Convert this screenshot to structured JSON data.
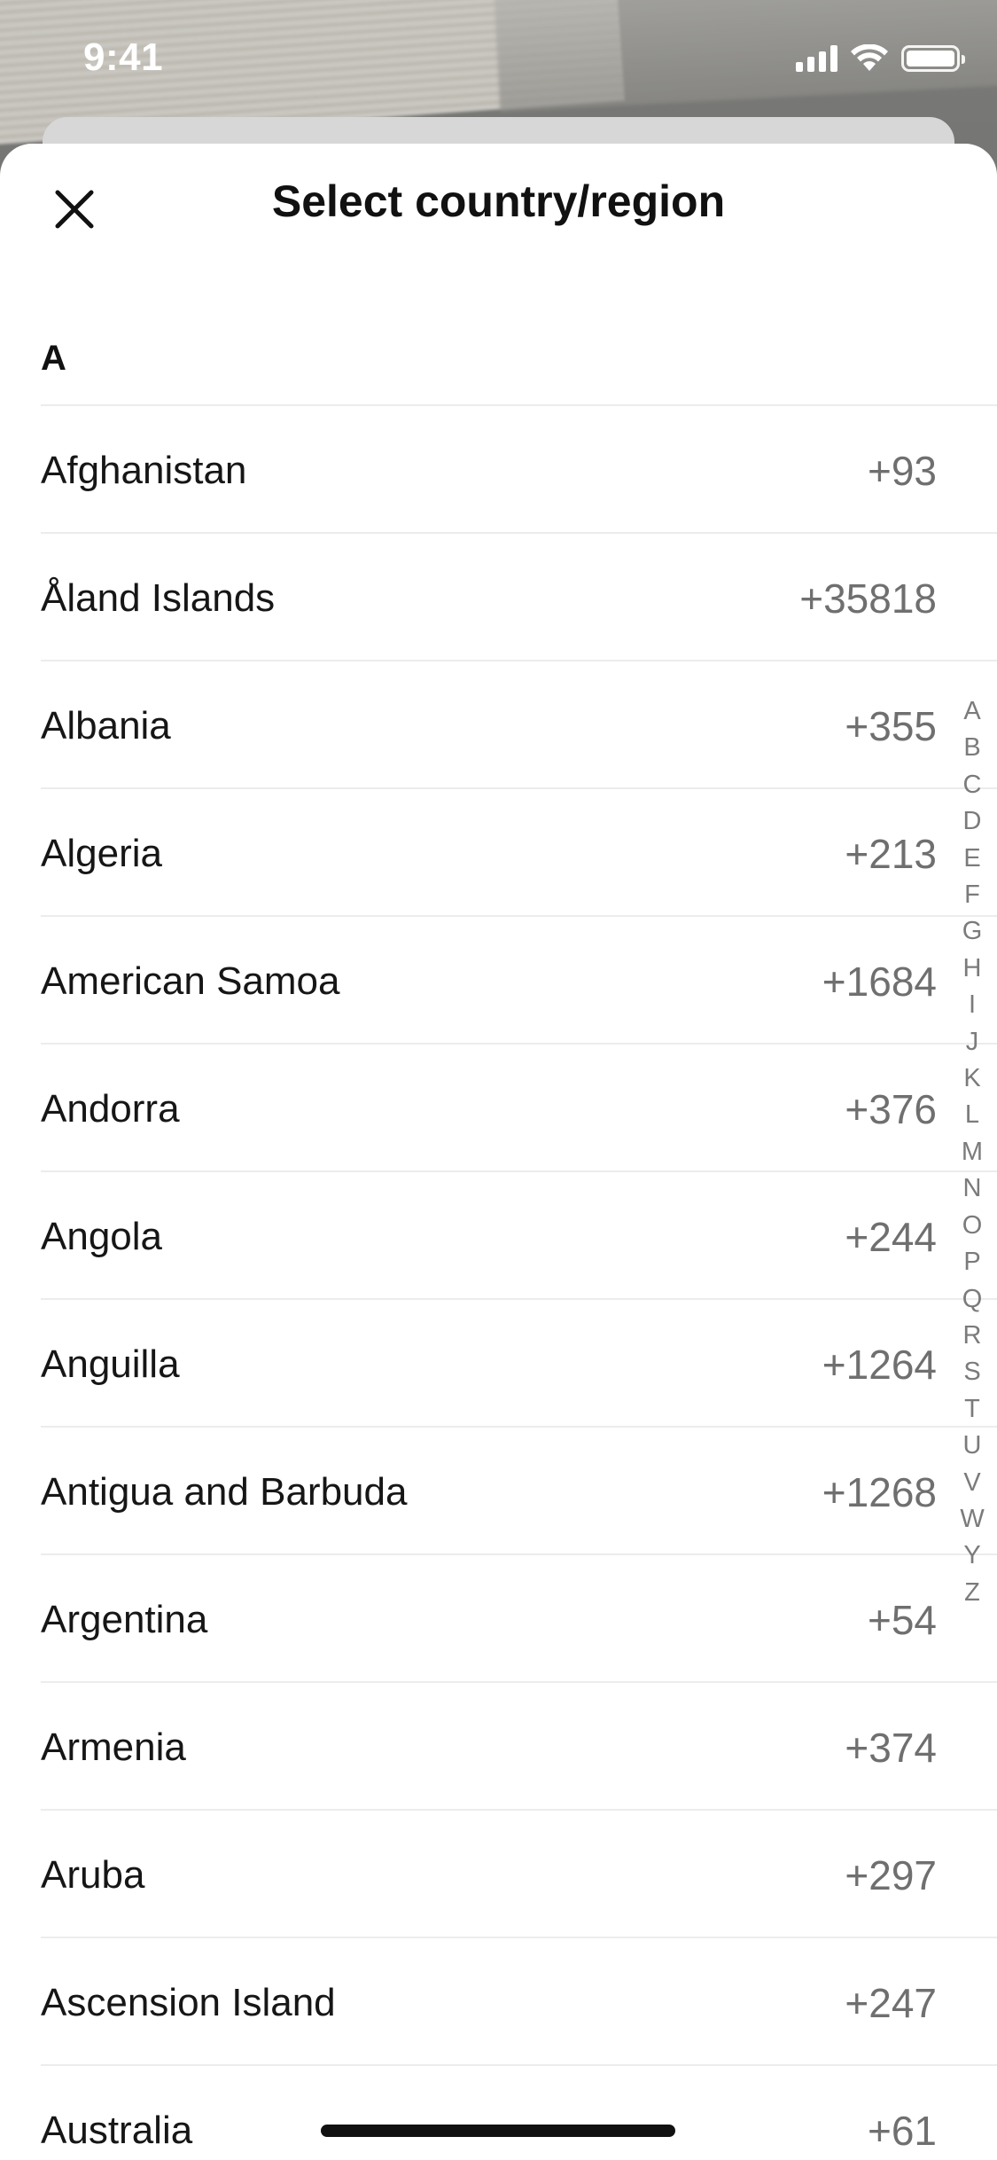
{
  "status_bar": {
    "time": "9:41"
  },
  "sheet": {
    "title": "Select country/region",
    "close_icon": "close-icon"
  },
  "section": {
    "letter": "A"
  },
  "countries": [
    {
      "name": "Afghanistan",
      "code": "+93"
    },
    {
      "name": "Åland Islands",
      "code": "+35818"
    },
    {
      "name": "Albania",
      "code": "+355"
    },
    {
      "name": "Algeria",
      "code": "+213"
    },
    {
      "name": "American Samoa",
      "code": "+1684"
    },
    {
      "name": "Andorra",
      "code": "+376"
    },
    {
      "name": "Angola",
      "code": "+244"
    },
    {
      "name": "Anguilla",
      "code": "+1264"
    },
    {
      "name": "Antigua and Barbuda",
      "code": "+1268"
    },
    {
      "name": "Argentina",
      "code": "+54"
    },
    {
      "name": "Armenia",
      "code": "+374"
    },
    {
      "name": "Aruba",
      "code": "+297"
    },
    {
      "name": "Ascension Island",
      "code": "+247"
    },
    {
      "name": "Australia",
      "code": "+61"
    }
  ],
  "alpha_index": [
    "A",
    "B",
    "C",
    "D",
    "E",
    "F",
    "G",
    "H",
    "I",
    "J",
    "K",
    "L",
    "M",
    "N",
    "O",
    "P",
    "Q",
    "R",
    "S",
    "T",
    "U",
    "V",
    "W",
    "Y",
    "Z"
  ],
  "colors": {
    "sheet_background": "#ffffff",
    "code_text": "#6f6f6f",
    "divider": "#ececec"
  }
}
